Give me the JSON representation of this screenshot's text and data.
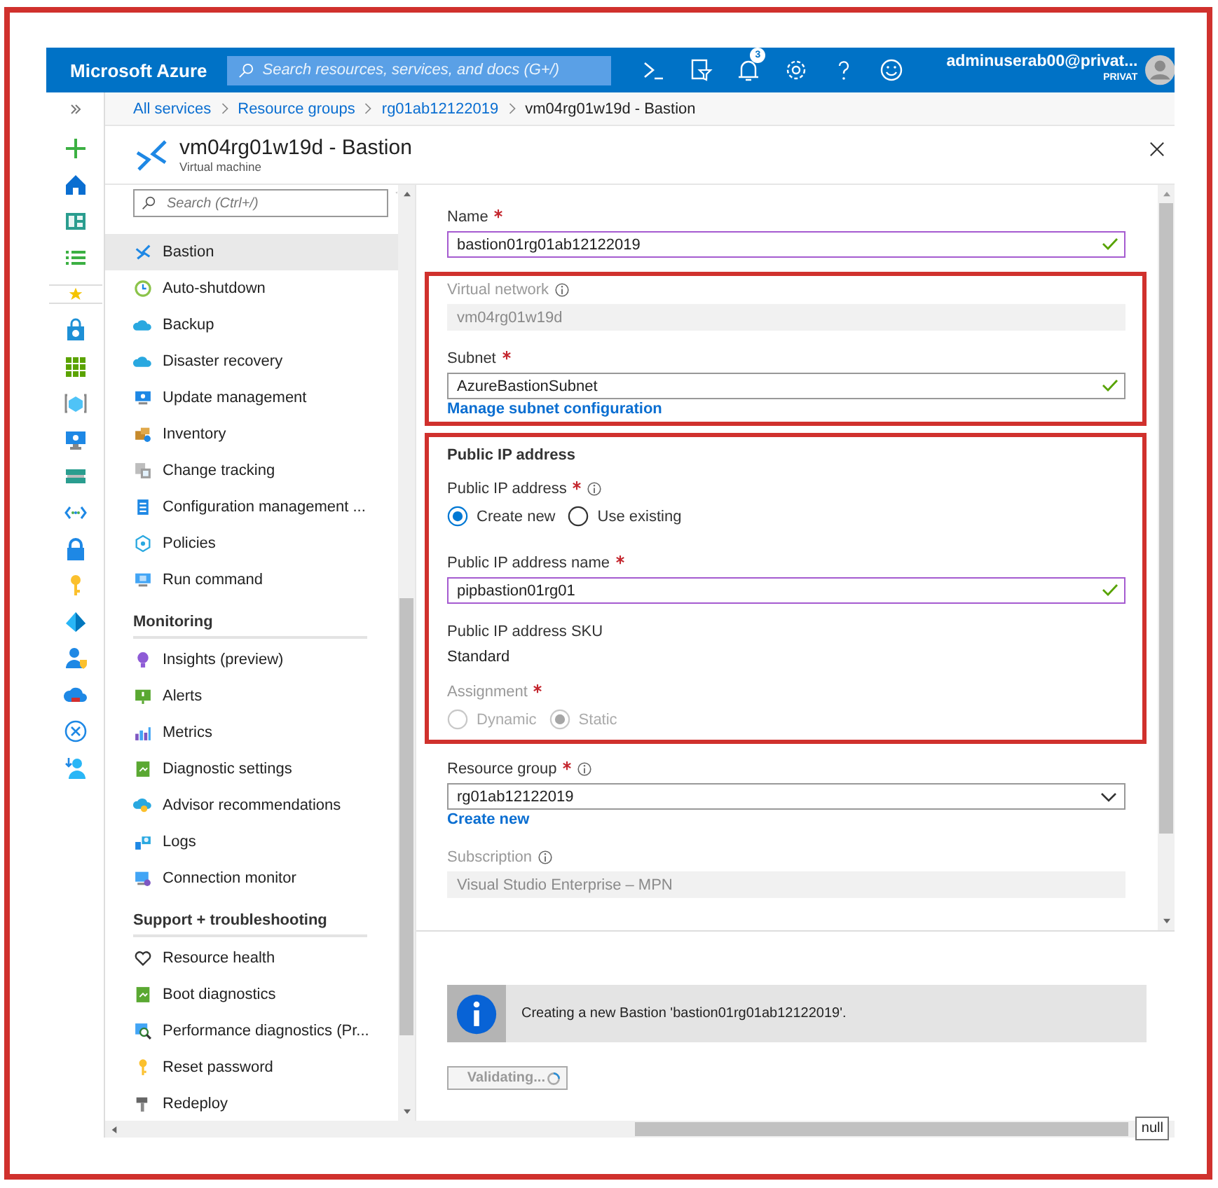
{
  "topbar": {
    "brand": "Microsoft Azure",
    "search": {
      "placeholder": "Search resources, services, and docs (G+/)"
    },
    "notification_count": "3",
    "user": {
      "name": "adminuserab00@privat...",
      "directory": "PRIVAT"
    }
  },
  "breadcrumb": [
    {
      "label": "All services",
      "current": false
    },
    {
      "label": "Resource groups",
      "current": false
    },
    {
      "label": "rg01ab12122019",
      "current": false
    },
    {
      "label": "vm04rg01w19d - Bastion",
      "current": true
    }
  ],
  "blade": {
    "title": "vm04rg01w19d - Bastion",
    "subtitle": "Virtual machine"
  },
  "menu": {
    "search": {
      "placeholder": "Search (Ctrl+/)"
    },
    "sections": [
      {
        "items": [
          {
            "label": "Bastion",
            "selected": true
          },
          {
            "label": "Auto-shutdown",
            "selected": false
          },
          {
            "label": "Backup",
            "selected": false
          },
          {
            "label": "Disaster recovery",
            "selected": false
          },
          {
            "label": "Update management",
            "selected": false
          },
          {
            "label": "Inventory",
            "selected": false
          },
          {
            "label": "Change tracking",
            "selected": false
          },
          {
            "label": "Configuration management ...",
            "selected": false
          },
          {
            "label": "Policies",
            "selected": false
          },
          {
            "label": "Run command",
            "selected": false
          }
        ]
      },
      {
        "heading": "Monitoring",
        "items": [
          {
            "label": "Insights (preview)",
            "selected": false
          },
          {
            "label": "Alerts",
            "selected": false
          },
          {
            "label": "Metrics",
            "selected": false
          },
          {
            "label": "Diagnostic settings",
            "selected": false
          },
          {
            "label": "Advisor recommendations",
            "selected": false
          },
          {
            "label": "Logs",
            "selected": false
          },
          {
            "label": "Connection monitor",
            "selected": false
          }
        ]
      },
      {
        "heading": "Support + troubleshooting",
        "items": [
          {
            "label": "Resource health",
            "selected": false
          },
          {
            "label": "Boot diagnostics",
            "selected": false
          },
          {
            "label": "Performance diagnostics (Pr...",
            "selected": false
          },
          {
            "label": "Reset password",
            "selected": false
          },
          {
            "label": "Redeploy",
            "selected": false
          }
        ]
      }
    ]
  },
  "form": {
    "groups": [
      {
        "fields": [
          {
            "kind": "text",
            "label": "Name",
            "required": true,
            "value": "bastion01rg01ab12122019",
            "disabled": false,
            "modified": true,
            "valid": true
          }
        ]
      },
      {
        "highlighted": true,
        "fields": [
          {
            "kind": "text",
            "label": "Virtual network",
            "info": true,
            "value": "vm04rg01w19d",
            "disabled": true,
            "modified": false
          },
          {
            "kind": "text",
            "label": "Subnet",
            "required": true,
            "value": "AzureBastionSubnet",
            "disabled": false,
            "modified": false,
            "valid": true
          },
          {
            "kind": "link",
            "label": "Manage subnet configuration"
          }
        ]
      },
      {
        "highlighted": true,
        "fields": [
          {
            "kind": "heading",
            "label": "Public IP address"
          },
          {
            "kind": "radio",
            "label": "Public IP address",
            "required": true,
            "info": true,
            "disabled": false,
            "options": [
              {
                "label": "Create new",
                "selected": true
              },
              {
                "label": "Use existing",
                "selected": false
              }
            ]
          },
          {
            "kind": "text",
            "label": "Public IP address name",
            "required": true,
            "value": "pipbastion01rg01",
            "disabled": false,
            "modified": true,
            "valid": true
          },
          {
            "kind": "static",
            "label": "Public IP address SKU",
            "value": "Standard"
          },
          {
            "kind": "radio",
            "label": "Assignment",
            "required": true,
            "disabled": true,
            "options": [
              {
                "label": "Dynamic",
                "selected": false
              },
              {
                "label": "Static",
                "selected": true
              }
            ]
          }
        ]
      },
      {
        "fields": [
          {
            "kind": "select",
            "label": "Resource group",
            "required": true,
            "info": true,
            "value": "rg01ab12122019"
          },
          {
            "kind": "link",
            "label": "Create new"
          },
          {
            "kind": "text",
            "label": "Subscription",
            "info": true,
            "value": "Visual Studio Enterprise – MPN",
            "disabled": true,
            "modified": false
          }
        ]
      }
    ]
  },
  "notice": {
    "text": "Creating a new Bastion 'bastion01rg01ab12122019'."
  },
  "action": {
    "label": "Validating...",
    "disabled": true
  },
  "tooltip": "null"
}
